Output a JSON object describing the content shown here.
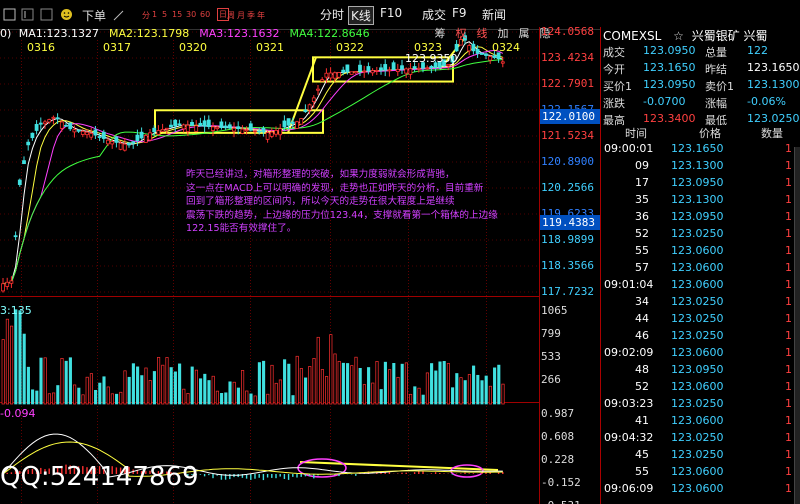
{
  "toolbar": {
    "action": "下单",
    "periods": [
      "分",
      "1",
      "5",
      "15",
      "30",
      "60",
      "日",
      "周",
      "月",
      "季",
      "年"
    ],
    "selected_period": "日",
    "split_hours": "15:30",
    "buttons": [
      "分时",
      "K线",
      "F10",
      "成交",
      "F9",
      "新闻"
    ],
    "active_button": "K线"
  },
  "chart_header": {
    "ma_lines": [
      {
        "label": "MA1:123.1327",
        "color": "#ffffff"
      },
      {
        "label": "MA2:123.1798",
        "color": "#ffff40"
      },
      {
        "label": "MA3:123.1632",
        "color": "#ff40ff"
      },
      {
        "label": "MA4:122.8646",
        "color": "#40ff40"
      }
    ],
    "left_cut": "0)",
    "badges": [
      "筹",
      "权",
      "线",
      "加",
      "属",
      "隐"
    ],
    "selected_badges": [
      "权",
      "线"
    ]
  },
  "chart_data": {
    "type": "candlestick",
    "instrument": "COMEXSL",
    "dates": [
      "0316",
      "0317",
      "0320",
      "0321",
      "0322",
      "0323",
      "0324"
    ],
    "price_axis": {
      "ticks": [
        "124.0568",
        "123.4234",
        "122.7901",
        "122.1567",
        "121.5234",
        "120.8900",
        "120.2566",
        "119.6233",
        "118.9899",
        "118.3566",
        "117.7232"
      ],
      "red_ticks": [
        "124.0568",
        "123.4234",
        "122.7901",
        "121.5234"
      ],
      "cyan_ticks": [
        "120.2566",
        "118.9899",
        "118.3566",
        "117.7232"
      ],
      "highlight_current": "122.0100",
      "highlight_cursor": "119.4383",
      "ylim": [
        117.7232,
        124.0568
      ]
    },
    "peak_label": "123.9350",
    "volume_panel": {
      "label": "3:135",
      "ticks": [
        "1065",
        "799",
        "533",
        "266"
      ]
    },
    "macd_panel": {
      "label": "-0.094",
      "ticks": [
        "0.987",
        "0.608",
        "0.228",
        "-0.152",
        "-0.531"
      ]
    }
  },
  "annotation": {
    "lines": [
      "昨天已经讲过，对箱形整理的突破，如果力度弱就会形成背驰，",
      "这一点在MACD上可以明确的发现，走势也正如昨天的分析，目前重新",
      "回到了箱形整理的区间内，所以今天的走势在很大程度上是继续",
      "震荡下跌的趋势，上边缘的压力位123.44，支撑就看第一个箱体的上边缘",
      "122.15能否有效撑住了。"
    ]
  },
  "watermark": "QQ:524147869",
  "quote": {
    "symbol": "COMEXSL",
    "name": "兴蜀银矿  兴蜀",
    "star": "☆",
    "fields": [
      {
        "label": "成交",
        "value": "123.0950",
        "vcolor": "#40d0ff",
        "label2": "总量",
        "value2": "122",
        "v2color": "#40d0ff"
      },
      {
        "label": "今开",
        "value": "123.1650",
        "vcolor": "#40d0ff",
        "label2": "昨结",
        "value2": "123.1650",
        "v2color": "#ffffff"
      },
      {
        "label": "买价1",
        "value": "123.0950",
        "vcolor": "#40d0ff",
        "label2": "卖价1",
        "value2": "123.1300",
        "v2color": "#40d0ff"
      },
      {
        "label": "涨跌",
        "value": "-0.0700",
        "vcolor": "#40d0ff",
        "label2": "涨幅",
        "value2": "-0.06%",
        "v2color": "#40d0ff"
      },
      {
        "label": "最高",
        "value": "123.3400",
        "vcolor": "#ff4040",
        "label2": "最低",
        "value2": "123.0250",
        "v2color": "#40d0ff"
      }
    ],
    "trade_header": {
      "time": "时间",
      "price": "价格",
      "qty": "数量"
    },
    "trades": [
      {
        "time": "09:00:01",
        "price": "123.1650",
        "qty": "1"
      },
      {
        "time": "09",
        "price": "123.1300",
        "qty": "1"
      },
      {
        "time": "17",
        "price": "123.0950",
        "qty": "1"
      },
      {
        "time": "35",
        "price": "123.1300",
        "qty": "1"
      },
      {
        "time": "36",
        "price": "123.0950",
        "qty": "1"
      },
      {
        "time": "52",
        "price": "123.0250",
        "qty": "1"
      },
      {
        "time": "55",
        "price": "123.0600",
        "qty": "1"
      },
      {
        "time": "57",
        "price": "123.0600",
        "qty": "1"
      },
      {
        "time": "09:01:04",
        "price": "123.0600",
        "qty": "1"
      },
      {
        "time": "34",
        "price": "123.0250",
        "qty": "1"
      },
      {
        "time": "44",
        "price": "123.0250",
        "qty": "1"
      },
      {
        "time": "46",
        "price": "123.0250",
        "qty": "1"
      },
      {
        "time": "09:02:09",
        "price": "123.0600",
        "qty": "1"
      },
      {
        "time": "48",
        "price": "123.0950",
        "qty": "1"
      },
      {
        "time": "52",
        "price": "123.0600",
        "qty": "1"
      },
      {
        "time": "09:03:23",
        "price": "123.0250",
        "qty": "1"
      },
      {
        "time": "41",
        "price": "123.0600",
        "qty": "1"
      },
      {
        "time": "09:04:32",
        "price": "123.0250",
        "qty": "1"
      },
      {
        "time": "45",
        "price": "123.0250",
        "qty": "1"
      },
      {
        "time": "55",
        "price": "123.0600",
        "qty": "1"
      },
      {
        "time": "09:06:09",
        "price": "123.0600",
        "qty": "1"
      }
    ]
  },
  "colors": {
    "up": "#ff3030",
    "down": "#40e0e0",
    "box": "#ffff40",
    "panel_border": "#a00000"
  }
}
